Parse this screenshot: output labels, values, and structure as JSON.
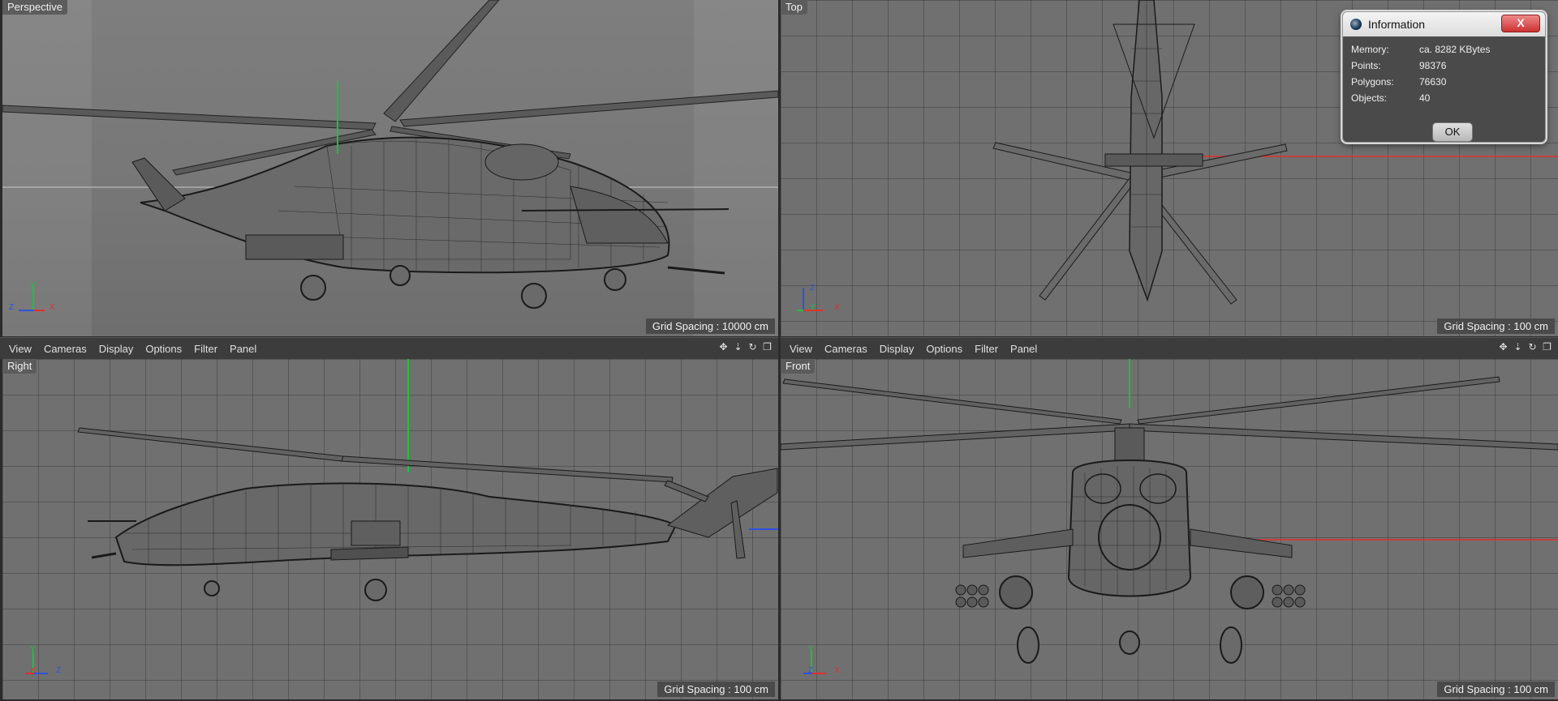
{
  "viewports": {
    "perspective": {
      "title": "Perspective",
      "grid_spacing": "Grid Spacing : 10000 cm"
    },
    "top": {
      "title": "Top",
      "grid_spacing": "Grid Spacing : 100 cm"
    },
    "right": {
      "title": "Right",
      "grid_spacing": "Grid Spacing : 100 cm"
    },
    "front": {
      "title": "Front",
      "grid_spacing": "Grid Spacing : 100 cm"
    }
  },
  "menubar": {
    "items": [
      "View",
      "Cameras",
      "Display",
      "Options",
      "Filter",
      "Panel"
    ]
  },
  "nav_icons": [
    "move-icon",
    "down-arrow-icon",
    "rotate-icon",
    "maximize-icon"
  ],
  "axes": {
    "x": "X",
    "y": "Y",
    "z": "Z"
  },
  "info_dialog": {
    "title": "Information",
    "close_label": "X",
    "rows": [
      {
        "label": "Memory:",
        "value": "ca. 8282 KBytes"
      },
      {
        "label": "Points:",
        "value": "98376"
      },
      {
        "label": "Polygons:",
        "value": "76630"
      },
      {
        "label": "Objects:",
        "value": "40"
      }
    ],
    "ok_label": "OK"
  },
  "colors": {
    "viewport_bg": "#707070",
    "axis_x": "#e03030",
    "axis_y": "#20c040",
    "axis_z": "#3050e0"
  }
}
